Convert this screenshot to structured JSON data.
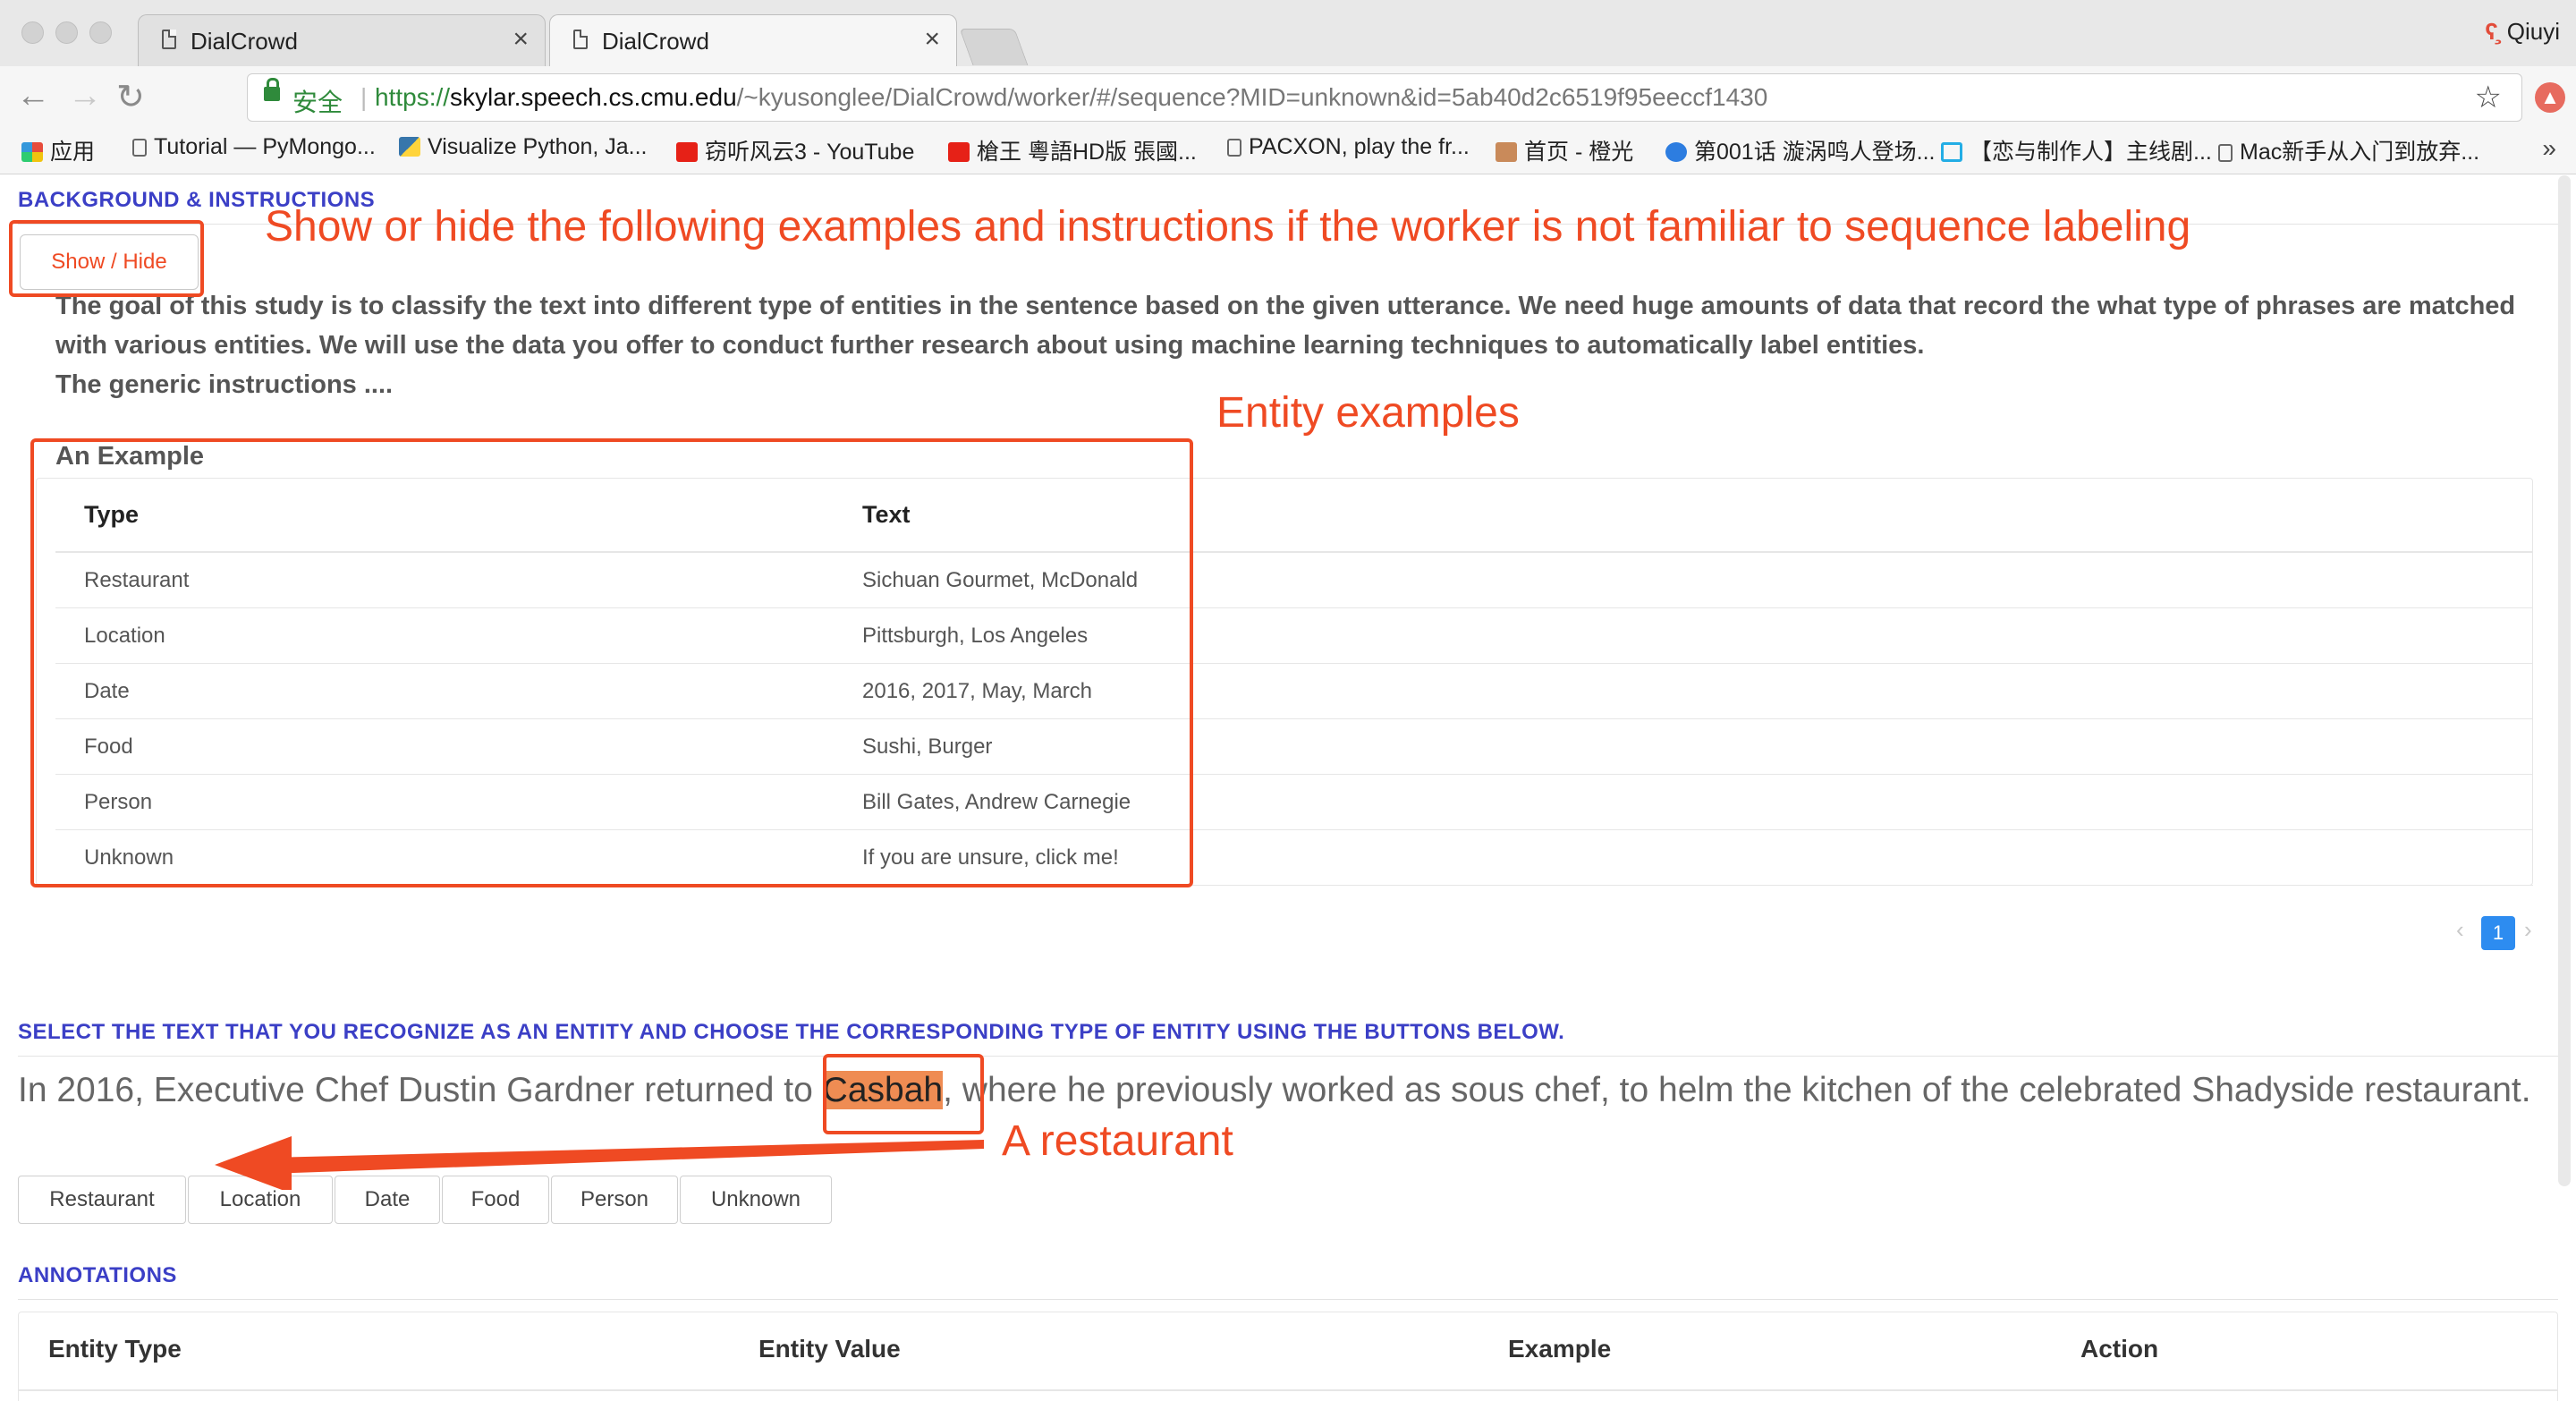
{
  "browser": {
    "tabs": [
      {
        "title": "DialCrowd",
        "close": "×",
        "active": false
      },
      {
        "title": "DialCrowd",
        "close": "×",
        "active": true
      }
    ],
    "profile_name": "Qiuyi",
    "secure_label": "安全",
    "url_scheme": "https://",
    "url_host": "skylar.speech.cs.cmu.edu",
    "url_path": "/~kyusonglee/DialCrowd/worker/#/sequence?MID=unknown&id=5ab40d2c6519f95eeccf1430",
    "bookmarks": [
      {
        "label": "应用",
        "icon": "apps-grid-icon"
      },
      {
        "label": "Tutorial — PyMongo...",
        "icon": "page-icon"
      },
      {
        "label": "Visualize Python, Ja...",
        "icon": "python-icon"
      },
      {
        "label": "窃听风云3 - YouTube",
        "icon": "youtube-icon"
      },
      {
        "label": "槍王 粵語HD版 張國...",
        "icon": "youtube-icon"
      },
      {
        "label": "PACXON, play the fr...",
        "icon": "page-icon"
      },
      {
        "label": "首页 - 橙光",
        "icon": "avatar-icon"
      },
      {
        "label": "第001话 漩涡鸣人登场...",
        "icon": "play-icon"
      },
      {
        "label": "【恋与制作人】主线剧...",
        "icon": "bilibili-icon"
      },
      {
        "label": "Mac新手从入门到放弃...",
        "icon": "page-icon"
      }
    ],
    "bookmarks_more": "»"
  },
  "background": {
    "heading": "BACKGROUND & INSTRUCTIONS",
    "toggle_button": "Show / Hide",
    "intro_paragraph": "The goal of this study is to classify the text into different type of entities in the sentence based on the given utterance. We need huge amounts of data that record the what type of phrases are matched with various entities. We will use the data you offer to conduct further research about using machine learning techniques to automatically label entities.",
    "generic_instructions": "The generic instructions ...."
  },
  "example": {
    "title": "An Example",
    "columns": [
      "Type",
      "Text"
    ],
    "rows": [
      [
        "Restaurant",
        "Sichuan Gourmet, McDonald"
      ],
      [
        "Location",
        "Pittsburgh, Los Angeles"
      ],
      [
        "Date",
        "2016, 2017, May, March"
      ],
      [
        "Food",
        "Sushi, Burger"
      ],
      [
        "Person",
        "Bill Gates, Andrew Carnegie"
      ],
      [
        "Unknown",
        "If you are unsure, click me!"
      ]
    ],
    "pagination": {
      "current_page": "1",
      "prev": "‹",
      "next": "›"
    }
  },
  "task": {
    "heading": "SELECT THE TEXT THAT YOU RECOGNIZE AS AN ENTITY AND CHOOSE THE CORRESPONDING TYPE OF ENTITY USING THE BUTTONS BELOW.",
    "sentence_before": "In 2016, Executive Chef Dustin Gardner returned to ",
    "sentence_highlight": "Casbah",
    "sentence_after": ", where he previously worked as sous chef, to helm the kitchen of the celebrated Shadyside restaurant.",
    "buttons": [
      "Restaurant",
      "Location",
      "Date",
      "Food",
      "Person",
      "Unknown"
    ]
  },
  "annotations": {
    "heading": "ANNOTATIONS",
    "columns": [
      "Entity Type",
      "Entity Value",
      "Example",
      "Action"
    ]
  },
  "overlay": {
    "toggle_note": "Show or hide the following examples and instructions if the worker is not familiar to sequence labeling",
    "entity_note": "Entity examples",
    "restaurant_note": "A restaurant",
    "annotation_color": "#ef4a23"
  }
}
